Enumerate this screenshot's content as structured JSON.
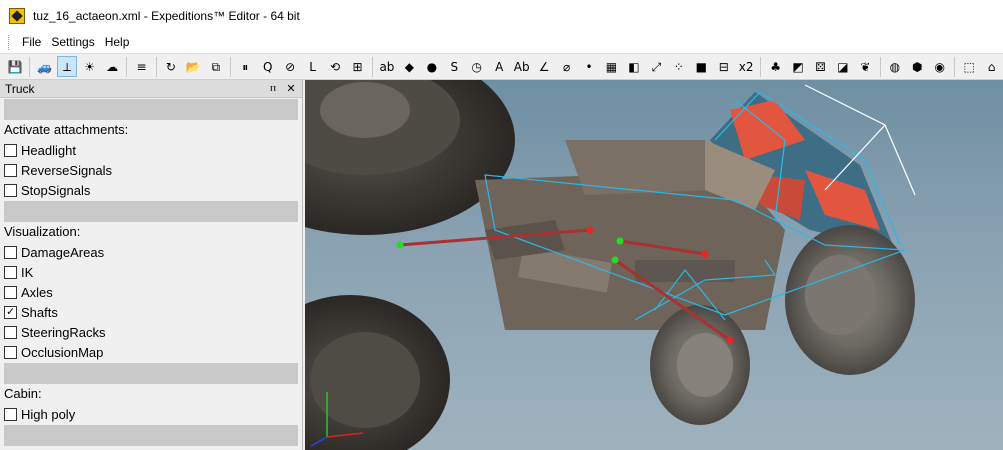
{
  "window": {
    "title": "tuz_16_actaeon.xml - Expeditions™ Editor - 64 bit"
  },
  "menu": {
    "items": [
      "File",
      "Settings",
      "Help"
    ]
  },
  "panel": {
    "title": "Truck",
    "pin_glyph": "ⲡ",
    "close_glyph": "✕",
    "sections": [
      {
        "title": "Activate attachments:",
        "items": [
          {
            "label": "Headlight",
            "checked": false
          },
          {
            "label": "ReverseSignals",
            "checked": false
          },
          {
            "label": "StopSignals",
            "checked": false
          }
        ]
      },
      {
        "title": "Visualization:",
        "items": [
          {
            "label": "DamageAreas",
            "checked": false
          },
          {
            "label": "IK",
            "checked": false
          },
          {
            "label": "Axles",
            "checked": false
          },
          {
            "label": "Shafts",
            "checked": true
          },
          {
            "label": "SteeringRacks",
            "checked": false
          },
          {
            "label": "OcclusionMap",
            "checked": false
          }
        ]
      },
      {
        "title": "Cabin:",
        "items": [
          {
            "label": "High poly",
            "checked": false
          }
        ]
      }
    ]
  },
  "toolbar": {
    "buttons": [
      {
        "icon": "save-icon",
        "glyph": "💾"
      },
      {
        "icon": "truck-icon",
        "glyph": "🚙"
      },
      {
        "icon": "axes-icon",
        "glyph": "⟂"
      },
      {
        "icon": "sun-cloud-icon",
        "glyph": "☀"
      },
      {
        "icon": "cloud-icon",
        "glyph": "☁"
      },
      {
        "icon": "text-align-icon",
        "glyph": "≡"
      },
      {
        "icon": "reload-icon",
        "glyph": "↻"
      },
      {
        "icon": "open-folder-icon",
        "glyph": "📂"
      },
      {
        "icon": "copy-icon",
        "glyph": "⧉"
      },
      {
        "icon": "pause-icon",
        "glyph": "⏸"
      },
      {
        "icon": "zoom-icon",
        "glyph": "Q"
      },
      {
        "icon": "ruler-icon",
        "glyph": "⊘"
      },
      {
        "icon": "angle-icon",
        "glyph": "L"
      },
      {
        "icon": "rotate-icon",
        "glyph": "⟲"
      },
      {
        "icon": "nodes-icon",
        "glyph": "⊞"
      },
      {
        "icon": "text-sample-icon",
        "glyph": "ab"
      },
      {
        "icon": "mask-icon",
        "glyph": "◆"
      },
      {
        "icon": "record-icon",
        "glyph": "●"
      },
      {
        "icon": "curve-icon",
        "glyph": "S"
      },
      {
        "icon": "stopwatch-icon",
        "glyph": "◷"
      },
      {
        "icon": "font-a-icon",
        "glyph": "A"
      },
      {
        "icon": "font-ab-icon",
        "glyph": "Ab"
      },
      {
        "icon": "measure-angle-icon",
        "glyph": "∠"
      },
      {
        "icon": "tape-icon",
        "glyph": "⌀"
      },
      {
        "icon": "light-icon",
        "glyph": "•"
      },
      {
        "icon": "palette-icon",
        "glyph": "▦"
      },
      {
        "icon": "cube-icon",
        "glyph": "◧"
      },
      {
        "icon": "graph-icon",
        "glyph": "⤢"
      },
      {
        "icon": "scatter-icon",
        "glyph": "⁘"
      },
      {
        "icon": "red-square-icon",
        "glyph": "■"
      },
      {
        "icon": "grid-icon",
        "glyph": "⊟"
      },
      {
        "icon": "x2-icon",
        "glyph": "x2"
      },
      {
        "icon": "bush-icon",
        "glyph": "♣"
      },
      {
        "icon": "brush-icon",
        "glyph": "◩"
      },
      {
        "icon": "dice-icon",
        "glyph": "⚄"
      },
      {
        "icon": "water-icon",
        "glyph": "◪"
      },
      {
        "icon": "leaf-icon",
        "glyph": "❦"
      },
      {
        "icon": "globe-icon",
        "glyph": "◍"
      },
      {
        "icon": "box-icon",
        "glyph": "⬢"
      },
      {
        "icon": "camera-icon",
        "glyph": "◉"
      },
      {
        "icon": "selection-icon",
        "glyph": "⬚"
      },
      {
        "icon": "home-icon",
        "glyph": "⌂"
      }
    ],
    "active_index": 2
  },
  "colors": {
    "viewport_bg": "#8aa2b2",
    "wireframe": "#2ab8e8",
    "shaft": "#b03030",
    "node_green": "#22dd22",
    "node_red": "#ee2222"
  }
}
